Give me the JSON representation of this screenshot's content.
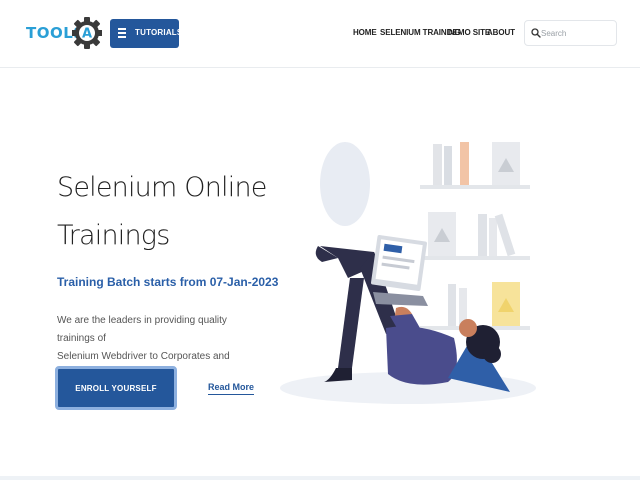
{
  "header": {
    "logo_text": "TOOLS",
    "logo_letter": "A",
    "tutorials_label": "TUTORIALS",
    "nav": [
      "HOME",
      "SELENIUM TRAINING",
      "DEMO SITE",
      "ABOUT"
    ],
    "search_placeholder": "Search"
  },
  "hero": {
    "title_line1": "Selenium Online",
    "title_line2": "Trainings",
    "subtitle": "Training Batch starts from 07-Jan-2023",
    "desc_line1": "We are the leaders in providing quality trainings of",
    "desc_line2": "Selenium Webdriver to Corporates and individuals",
    "enroll_label": "ENROLL YOURSELF",
    "readmore_label": "Read More"
  },
  "colors": {
    "brand_blue": "#24579b",
    "logo_blue": "#2a9fd6",
    "accent_yellow": "#f7e39a"
  },
  "icons": {
    "logo": "gear-icon",
    "tutorials": "hamburger-icon",
    "search": "search-icon"
  }
}
